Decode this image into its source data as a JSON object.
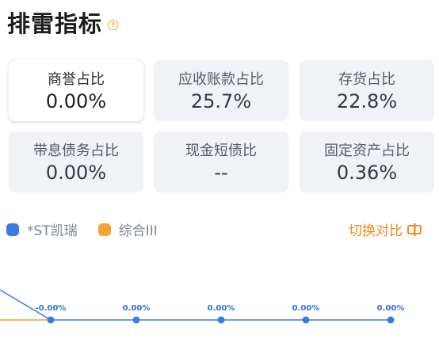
{
  "header": {
    "title": "排雷指标",
    "help_icon": "question-circle-icon"
  },
  "metrics": [
    {
      "label": "商誉占比",
      "value": "0.00%",
      "active": true
    },
    {
      "label": "应收账款占比",
      "value": "25.7%",
      "active": false
    },
    {
      "label": "存货占比",
      "value": "22.8%",
      "active": false
    },
    {
      "label": "带息债务占比",
      "value": "0.00%",
      "active": false
    },
    {
      "label": "现金短债比",
      "value": "--",
      "active": false
    },
    {
      "label": "固定资产占比",
      "value": "0.36%",
      "active": false
    }
  ],
  "legend": {
    "items": [
      {
        "name": "*ST凯瑞",
        "color": "#3a7bea"
      },
      {
        "name": "综合III",
        "color": "#f7a233"
      }
    ]
  },
  "switch": {
    "label": "切换对比",
    "icon": "switch-toggle-icon",
    "color": "#f08a24"
  },
  "chart_data": {
    "type": "line",
    "series": [
      {
        "name": "*ST凯瑞",
        "color": "#3a7bea",
        "labels": [
          "-0.00%",
          "0.00%",
          "0.00%",
          "0.00%",
          "0.00%"
        ],
        "values": [
          0,
          0,
          0,
          0,
          0
        ]
      },
      {
        "name": "综合III",
        "color": "#f7a233"
      }
    ]
  }
}
